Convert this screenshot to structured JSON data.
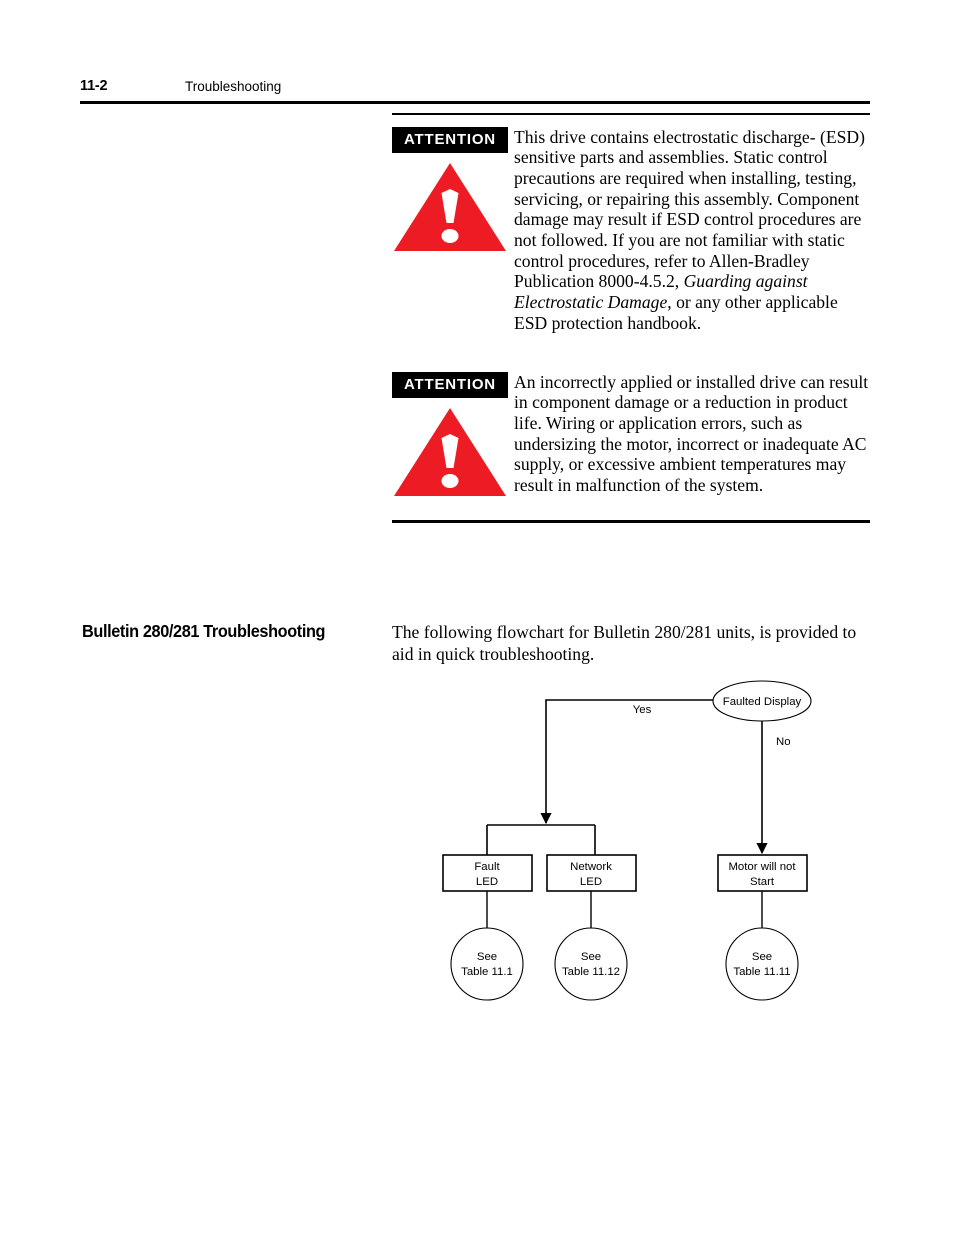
{
  "header": {
    "page_number": "11-2",
    "title": "Troubleshooting"
  },
  "attentions": [
    {
      "banner": "ATTENTION",
      "icon": "warning-triangle-icon",
      "text_part1": "This drive contains electrostatic discharge- (ESD) sensitive parts and assemblies. Static control precautions are required when installing, testing, servicing, or repairing this assembly. Component damage may result if ESD control procedures are not followed. If you are not familiar with static control procedures, refer to Allen-Bradley Publication 8000-4.5.2, ",
      "text_italic": "Guarding against Electrostatic Damage",
      "text_part2": ", or any other applicable ESD protection handbook."
    },
    {
      "banner": "ATTENTION",
      "icon": "warning-triangle-icon",
      "text_part1": "An incorrectly applied or installed drive can result in component damage or a reduction in product life. Wiring or application errors, such as undersizing the motor, incorrect or inadequate AC supply, or excessive ambient temperatures may result in malfunction of the system.",
      "text_italic": "",
      "text_part2": ""
    }
  ],
  "section": {
    "heading": "Bulletin 280/281 Troubleshooting",
    "intro": "The following flowchart for Bulletin 280/281 units, is provided to aid in quick troubleshooting."
  },
  "flowchart": {
    "nodes": {
      "decision": {
        "line1": "Faulted Display"
      },
      "fault_led": {
        "line1": "Fault",
        "line2": "LED"
      },
      "network_led": {
        "line1": "Network",
        "line2": "LED"
      },
      "motor_not_start": {
        "line1": "Motor will not",
        "line2": "Start"
      },
      "table_111": {
        "line1": "See",
        "line2": "Table 11.1"
      },
      "table_1112": {
        "line1": "See",
        "line2": "Table 11.12"
      },
      "table_1111": {
        "line1": "See",
        "line2": "Table 11.11"
      }
    },
    "edges": {
      "yes_label": "Yes",
      "no_label": "No"
    }
  },
  "colors": {
    "attention_red": "#ed1c24",
    "rule_black": "#000000",
    "page_background": "#ffffff"
  }
}
